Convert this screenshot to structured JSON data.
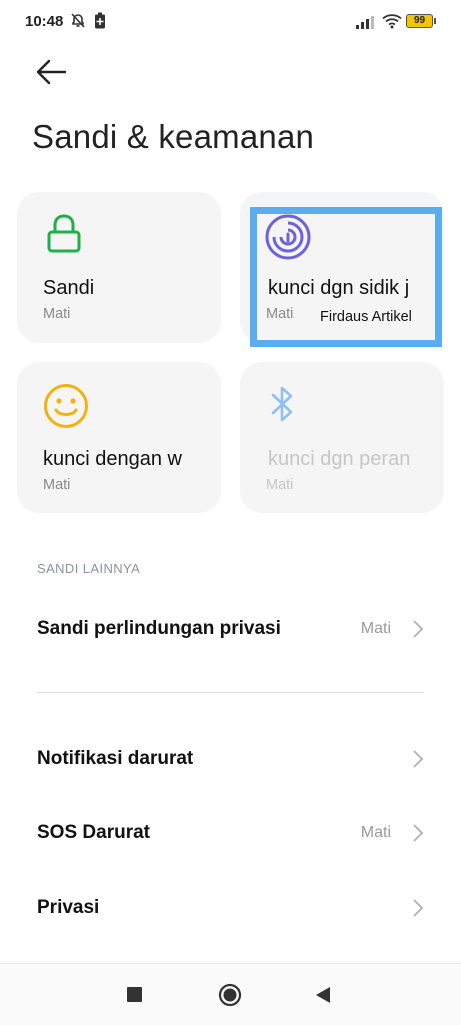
{
  "status_bar": {
    "time": "10:48",
    "battery": "99",
    "icons": [
      "alarm-off-icon",
      "battery-saver-icon",
      "signal-icon",
      "wifi-icon",
      "battery-icon"
    ]
  },
  "header": {
    "back_icon": "arrow-left-icon",
    "title": "Sandi & keamanan"
  },
  "cards": [
    {
      "title": "Sandi",
      "status": "Mati",
      "icon": "lock-icon",
      "color": "#1cb14c"
    },
    {
      "title": "kunci dgn sidik j",
      "status": "Mati",
      "icon": "fingerprint-icon",
      "color": "#6d63d8"
    },
    {
      "title": "kunci dengan w",
      "status": "Mati",
      "icon": "face-icon",
      "color": "#f2b10f"
    },
    {
      "title": "kunci dgn peran",
      "status": "Mati",
      "icon": "bluetooth-icon",
      "color": "#8fc1f2"
    }
  ],
  "watermark": "Firdaus Artikel",
  "section_label": "SANDI LAINNYA",
  "rows": [
    {
      "label": "Sandi perlindungan privasi",
      "value": "Mati"
    },
    {
      "label": "Notifikasi darurat",
      "value": ""
    },
    {
      "label": "SOS Darurat",
      "value": "Mati"
    },
    {
      "label": "Privasi",
      "value": ""
    }
  ],
  "navbar": {
    "icons": [
      "recents-square-icon",
      "home-circle-icon",
      "back-triangle-icon"
    ]
  },
  "colors": {
    "highlight": "#5aaef0",
    "card_bg": "#f5f5f5",
    "muted_text": "#8a8a8a"
  }
}
